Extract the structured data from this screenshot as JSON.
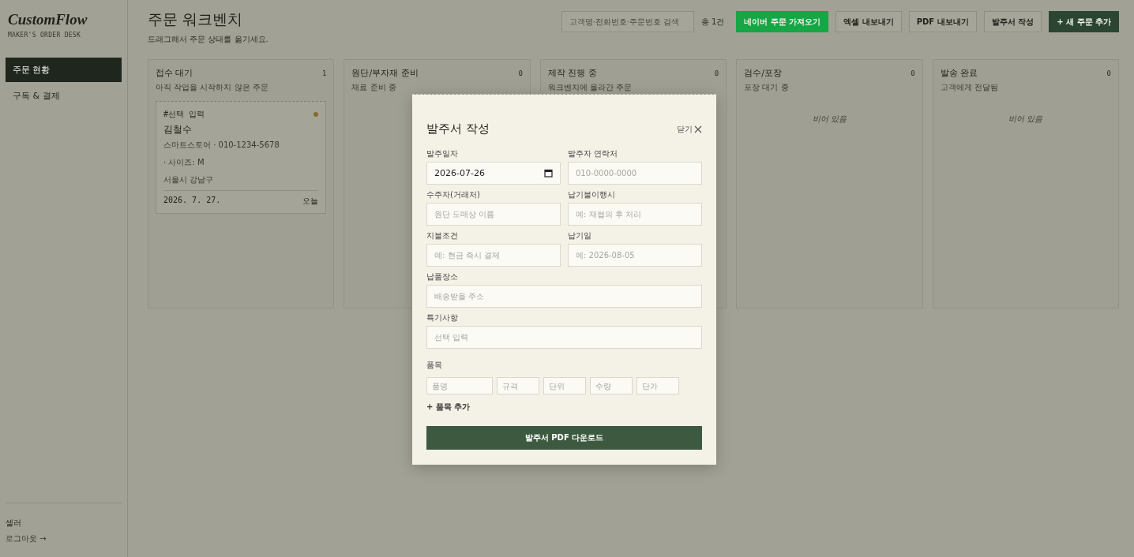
{
  "sidebar": {
    "logo": "CustomFlow",
    "tagline": "MAKER'S ORDER DESK",
    "nav": [
      {
        "label": "주문 현황",
        "selected": true
      },
      {
        "label": "구독 & 결제",
        "selected": false
      }
    ],
    "user": "셀러",
    "logout": "로그아웃 →"
  },
  "header": {
    "title": "주문 워크벤치",
    "subtitle": "드래그해서 주문 상태를 옮기세요.",
    "search": {
      "placeholder": "고객명·전화번호·주문번호 검색"
    },
    "total": "총 1건",
    "buttons": [
      {
        "label": "네이버 주문 가져오기",
        "kind": "naver"
      },
      {
        "label": "엑셀 내보내기",
        "kind": "plain"
      },
      {
        "label": "PDF 내보내기",
        "kind": "plain"
      },
      {
        "label": "발주서 작성",
        "kind": "plain"
      },
      {
        "label": "+ 새 주문 추가",
        "kind": "primary"
      }
    ]
  },
  "columns": [
    {
      "title": "접수 대기",
      "count": "1",
      "subtitle": "아직 작업을 시작하지 않은 주문",
      "cards": [
        {
          "tag": "#선택 입력",
          "color": "#8a6a2c",
          "name": "김철수",
          "contact": "스마트스토어 · 010-1234-5678",
          "option": "· 사이즈: M",
          "address": "서울시 강남구",
          "date": "2026. 7. 27.",
          "due": "오늘"
        }
      ]
    },
    {
      "title": "원단/부자재 준비",
      "count": "0",
      "subtitle": "재료 준비 중"
    },
    {
      "title": "제작 진행 중",
      "count": "0",
      "subtitle": "워크벤치에 올라간 주문"
    },
    {
      "title": "검수/포장",
      "count": "0",
      "subtitle": "포장 대기 중",
      "empty": "비어 있음"
    },
    {
      "title": "발송 완료",
      "count": "0",
      "subtitle": "고객에게 전달됨",
      "empty": "비어 있음"
    }
  ],
  "modal": {
    "title": "발주서 작성",
    "close": "닫기",
    "fields": [
      {
        "label": "발주일자",
        "value": "2026-07-26",
        "kind": "date"
      },
      {
        "label": "발주자 연락처",
        "placeholder": "010-0000-0000",
        "kind": "text"
      },
      {
        "label": "수주자(거래처)",
        "placeholder": "원단 도매상 이름",
        "kind": "text"
      },
      {
        "label": "납기불이행시",
        "placeholder": "예: 재협의 후 처리",
        "kind": "text"
      },
      {
        "label": "지불조건",
        "placeholder": "예: 현금 즉시 결제",
        "kind": "text"
      },
      {
        "label": "납기일",
        "placeholder": "예: 2026-08-05",
        "kind": "text"
      },
      {
        "label": "납품장소",
        "placeholder": "배송받을 주소",
        "kind": "wide"
      },
      {
        "label": "특기사항",
        "placeholder": "선택 입력",
        "kind": "wide"
      }
    ],
    "items_label": "품목",
    "item_fields": [
      {
        "placeholder": "품명",
        "kind": "name"
      },
      {
        "placeholder": "규격",
        "kind": "small"
      },
      {
        "placeholder": "단위",
        "kind": "small"
      },
      {
        "placeholder": "수량",
        "kind": "small"
      },
      {
        "placeholder": "단가",
        "kind": "small"
      }
    ],
    "add_item": "+ 품목 추가",
    "submit": "발주서 PDF 다운로드"
  }
}
